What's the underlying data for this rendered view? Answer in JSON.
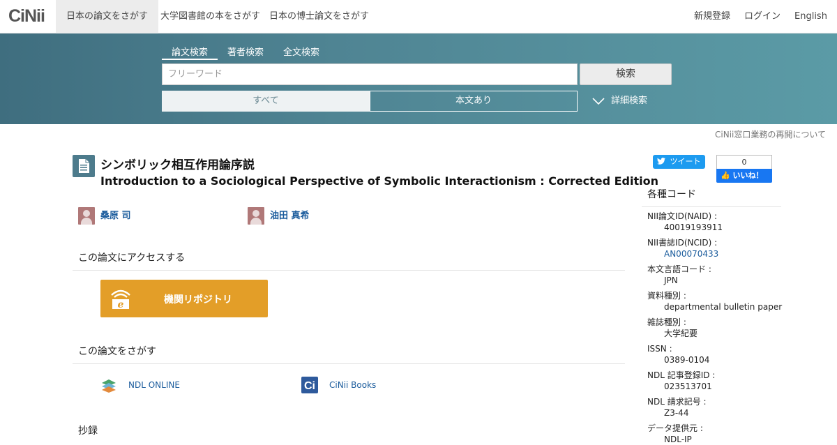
{
  "brand": {
    "logo": "CiNii"
  },
  "nav": {
    "tabs": [
      {
        "label": "日本の論文をさがす"
      },
      {
        "label": "大学図書館の本をさがす"
      },
      {
        "label": "日本の博士論文をさがす"
      }
    ],
    "right": {
      "register": "新規登録",
      "login": "ログイン",
      "lang": "English"
    }
  },
  "search": {
    "tabs": [
      {
        "label": "論文検索"
      },
      {
        "label": "著者検索"
      },
      {
        "label": "全文検索"
      }
    ],
    "placeholder": "フリーワード",
    "button": "検索",
    "filters": {
      "all": "すべて",
      "fulltext": "本文あり"
    },
    "advanced": "詳細検索"
  },
  "notice": "CiNii窓口業務の再開について",
  "article": {
    "title_ja": "シンボリック相互作用論序説",
    "title_en": "Introduction to a Sociological Perspective of Symbolic Interactionism : Corrected Edition",
    "authors": [
      {
        "name": "桑原 司"
      },
      {
        "name": "油田 真希"
      }
    ]
  },
  "access": {
    "heading": "この論文にアクセスする",
    "repository_button": "機関リポジトリ"
  },
  "find": {
    "heading": "この論文をさがす",
    "links": [
      {
        "label": "NDL ONLINE"
      },
      {
        "label": "CiNii Books"
      }
    ]
  },
  "abstract": {
    "heading": "抄録"
  },
  "social": {
    "tweet": "ツイート",
    "like_count": "0",
    "like": "いいね！"
  },
  "codes": {
    "heading": "各種コード",
    "items": [
      {
        "label": "NII論文ID(NAID) :",
        "value": "40019193911"
      },
      {
        "label": "NII書誌ID(NCID) :",
        "value": "AN00070433"
      },
      {
        "label": "本文言語コード :",
        "value": "JPN"
      },
      {
        "label": "資料種別 :",
        "value": "departmental bulletin paper"
      },
      {
        "label": "雑誌種別 :",
        "value": "大学紀要"
      },
      {
        "label": "ISSN :",
        "value": "0389-0104"
      },
      {
        "label": "NDL 記事登録ID :",
        "value": "023513701"
      },
      {
        "label": "NDL 請求記号 :",
        "value": "Z3-44"
      },
      {
        "label": "データ提供元 :",
        "value": "NDL-IP"
      }
    ]
  },
  "colors": {
    "band_start": "#3f6e7f",
    "band_end": "#5b9ba6",
    "repo_button": "#e39e28",
    "link": "#1a5b9c"
  }
}
